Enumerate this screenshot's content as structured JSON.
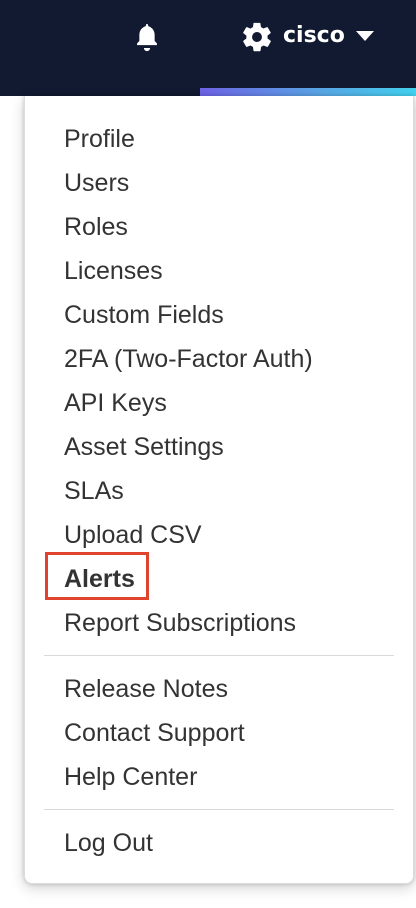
{
  "header": {
    "notification_icon": "bell-icon",
    "settings_icon": "gear-icon",
    "username": "cisco",
    "dropdown_icon": "caret-down-icon",
    "background_color": "#121a31",
    "accent_gradient": [
      "#6e63e6",
      "#42d3f0"
    ]
  },
  "menu": {
    "group1": [
      "Profile",
      "Users",
      "Roles",
      "Licenses",
      "Custom Fields",
      "2FA (Two-Factor Auth)",
      "API Keys",
      "Asset Settings",
      "SLAs",
      "Upload CSV",
      "Alerts",
      "Report Subscriptions"
    ],
    "group2": [
      "Release Notes",
      "Contact Support",
      "Help Center"
    ],
    "group3": [
      "Log Out"
    ],
    "highlighted_item": "Alerts",
    "highlight_color": "#e0442e"
  }
}
